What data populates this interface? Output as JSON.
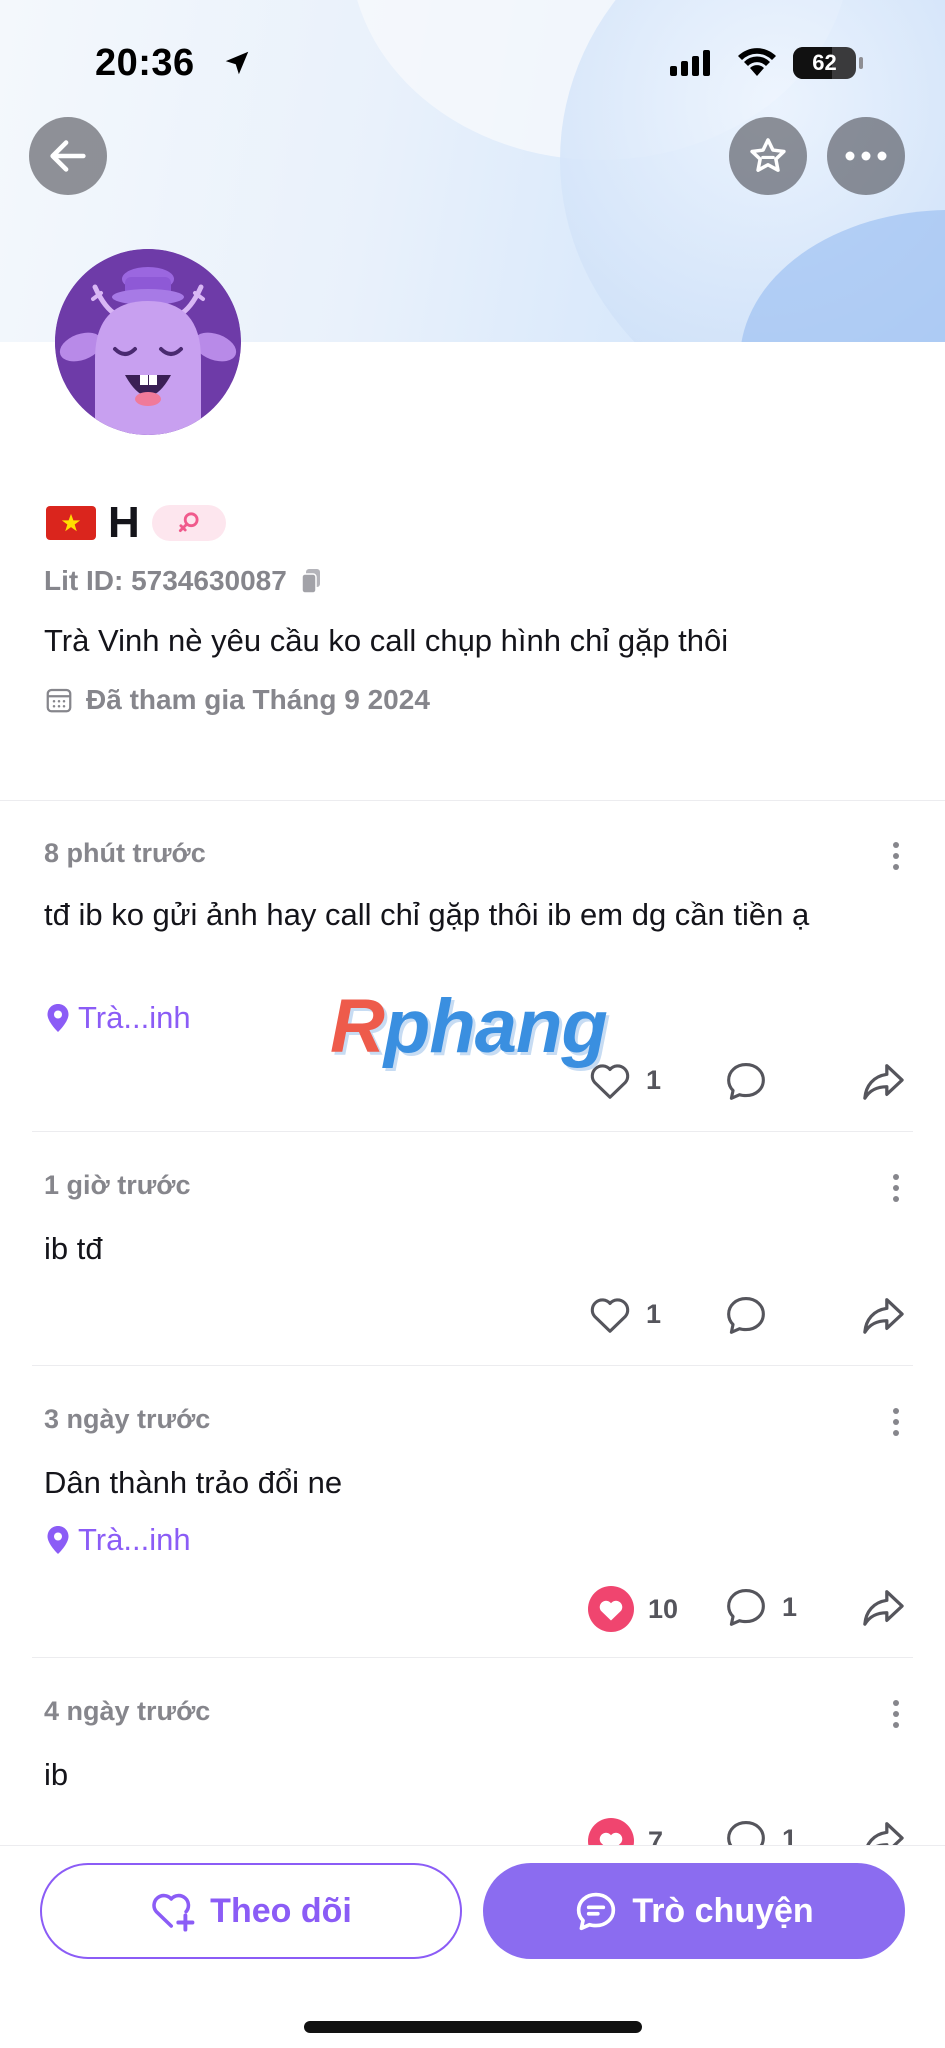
{
  "status_bar": {
    "time": "20:36",
    "battery": "62",
    "battery_level": 0.62
  },
  "header": {
    "back_icon": "arrow-left-icon",
    "favorite_icon": "star-outline-icon",
    "more_icon": "more-horizontal-icon"
  },
  "profile": {
    "flag": "vietnam-flag-icon",
    "name": "H",
    "gender_icon": "female-icon",
    "lit_id": "Lit ID: 5734630087",
    "bio": "Trà Vinh nè yêu cầu ko call chụp hình chỉ gặp thôi",
    "joined": "Đã tham gia Tháng 9 2024"
  },
  "watermark": {
    "first": "R",
    "rest": "phang"
  },
  "posts": [
    {
      "time": "8 phút trước",
      "content": "tđ ib ko gửi ảnh hay call chỉ gặp thôi ib em dg cần tiền ạ",
      "location": "Trà...inh",
      "likes": "1",
      "liked": false,
      "comments": ""
    },
    {
      "time": "1 giờ trước",
      "content": "ib tđ",
      "likes": "1",
      "liked": false,
      "comments": ""
    },
    {
      "time": "3 ngày trước",
      "content": "Dân thành trảo đổi ne",
      "location": "Trà...inh",
      "likes": "10",
      "liked": true,
      "comments": "1"
    },
    {
      "time": "4 ngày trước",
      "content": "ib",
      "likes": "7",
      "liked": true,
      "comments": "1"
    }
  ],
  "bottom": {
    "follow_label": "Theo dõi",
    "chat_label": "Trò chuyện"
  },
  "colors": {
    "accent": "#8b5cf6",
    "like": "#f0456f",
    "muted": "#86868c"
  }
}
